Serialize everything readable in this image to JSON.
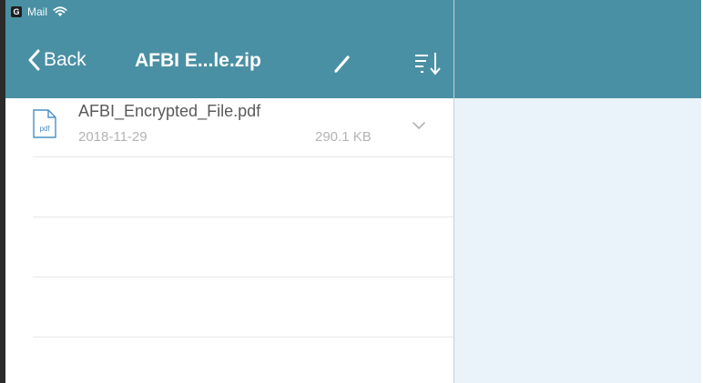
{
  "status_bar": {
    "app_badge": "G",
    "carrier": "Mail",
    "wifi_icon": "wifi-icon"
  },
  "nav": {
    "back_label": "Back",
    "title": "AFBI E...le.zip",
    "edit_icon": "pencil-icon",
    "sort_icon": "sort-icon"
  },
  "files": [
    {
      "name": "AFBI_Encrypted_File.pdf",
      "date": "2018-11-29",
      "size": "290.1 KB",
      "icon": "pdf-file-icon",
      "icon_label": "pdf"
    }
  ],
  "colors": {
    "nav_bar": "#4a90a4",
    "detail_pane": "#eaf3f9",
    "text_primary": "#5a5a5a",
    "text_secondary": "#b3b3b3"
  }
}
